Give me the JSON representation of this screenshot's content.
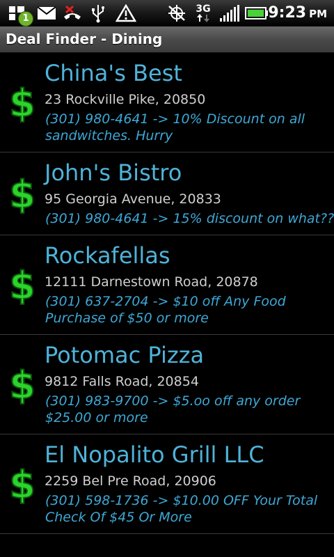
{
  "status_bar": {
    "notification_count": "1",
    "network": "3G",
    "time": "9:23",
    "ampm": "PM",
    "icons": [
      "notification-icon",
      "mail-icon",
      "missed-call-icon",
      "usb-icon",
      "warning-icon",
      "gps-off-icon",
      "data-3g-icon",
      "signal-icon",
      "battery-icon"
    ]
  },
  "header": {
    "title": "Deal Finder - Dining"
  },
  "deals": [
    {
      "name": "China's Best",
      "address": "23 Rockville Pike, 20850",
      "deal": "(301) 980-4641 -> 10% Discount on all sandwitches. Hurry"
    },
    {
      "name": "John's Bistro",
      "address": "95 Georgia Avenue, 20833",
      "deal": "(301) 980-4641 -> 15% discount on what??"
    },
    {
      "name": "Rockafellas",
      "address": "12111 Darnestown Road, 20878",
      "deal": "(301) 637-2704 -> $10 off Any Food Purchase of $50 or more"
    },
    {
      "name": "Potomac Pizza",
      "address": "9812 Falls Road, 20854",
      "deal": "(301) 983-9700 -> $5.oo off any order $25.00 or more"
    },
    {
      "name": "El Nopalito Grill LLC",
      "address": "2259 Bel Pre Road, 20906",
      "deal": "(301) 598-1736 -> $10.00 OFF Your Total Check Of $45 Or More"
    }
  ],
  "colors": {
    "name": "#4fb3d9",
    "deal": "#3ea8d6",
    "dollar": "#2bd32b"
  }
}
